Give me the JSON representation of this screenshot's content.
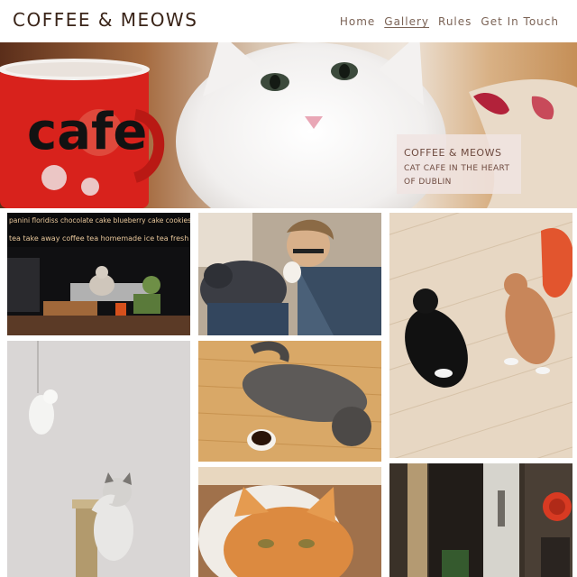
{
  "site": {
    "title": "COFFEE & MEOWS"
  },
  "nav": [
    {
      "label": "Home",
      "active": false
    },
    {
      "label": "Gallery",
      "active": true
    },
    {
      "label": "Rules",
      "active": false
    },
    {
      "label": "Get In Touch",
      "active": false
    }
  ],
  "hero": {
    "heading": "COFFEE & MEOWS",
    "subheading": "CAT CAFE IN THE HEART OF DUBLIN",
    "mug_text": "cafe"
  },
  "gallery": {
    "items": [
      {
        "name": "cafe-window-cat-photo",
        "chalkboard_text": "panini  floridiss  chocolate cake  blueberry cake  cookies  gelato  tea  take away coffee  tea  homemade ice tea  fresh orange juice  home"
      },
      {
        "name": "man-hugging-cat-photo"
      },
      {
        "name": "two-cats-on-floor-photo"
      },
      {
        "name": "kitten-playing-mouse-toy-photo"
      },
      {
        "name": "cat-lying-beside-coffee-photo"
      },
      {
        "name": "orange-cat-in-cat-house-photo"
      },
      {
        "name": "cafe-entrance-door-photo"
      }
    ]
  },
  "colors": {
    "brand_text": "#3a2418",
    "nav_text": "#7b6356",
    "overlay_bg": "#f0e4e2",
    "overlay_text": "#6e4a3f",
    "mug_red": "#d8221c"
  }
}
